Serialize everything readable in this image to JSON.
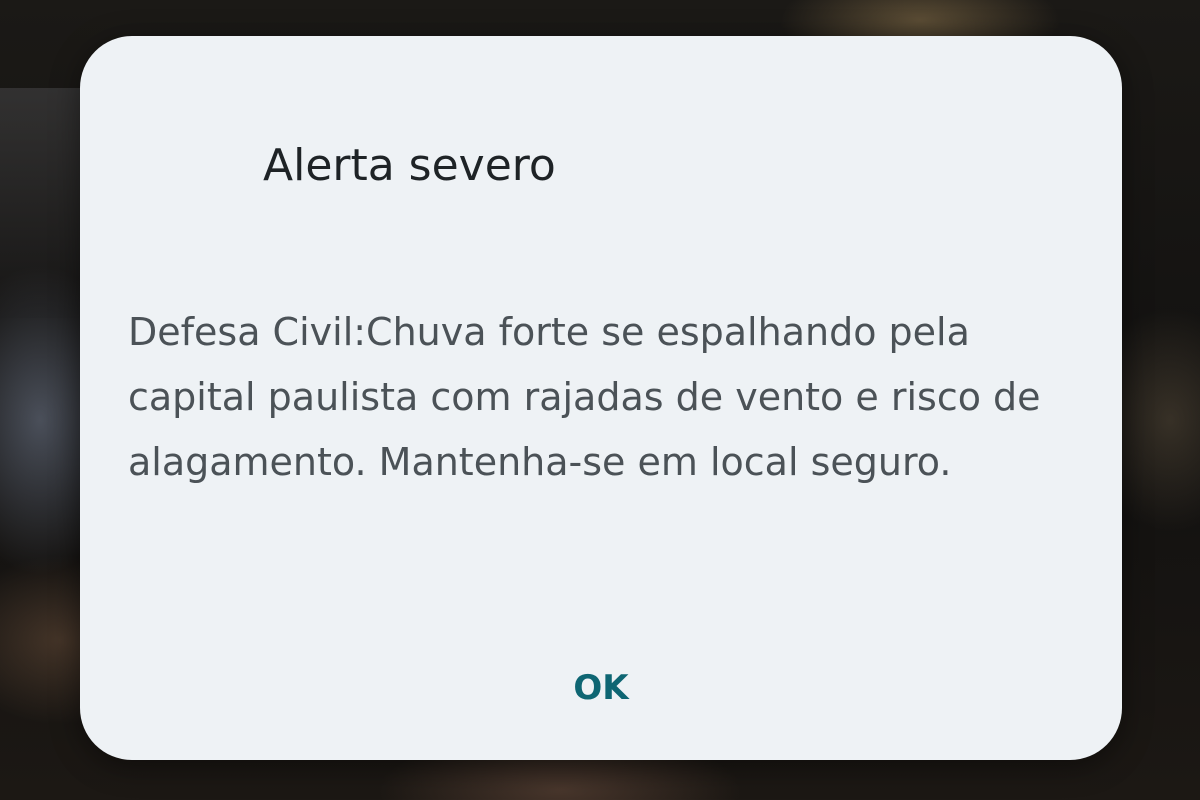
{
  "alert": {
    "title": "Alerta severo",
    "message": "Defesa Civil:Chuva forte se espalhando pela capital paulista com rajadas de vento e risco de alagamento. Mantenha-se em local seguro.",
    "ok_label": "OK"
  },
  "colors": {
    "dialog_background": "#eef2f5",
    "title_text": "#1e2326",
    "message_text": "#4b5257",
    "accent": "#0e6673"
  }
}
